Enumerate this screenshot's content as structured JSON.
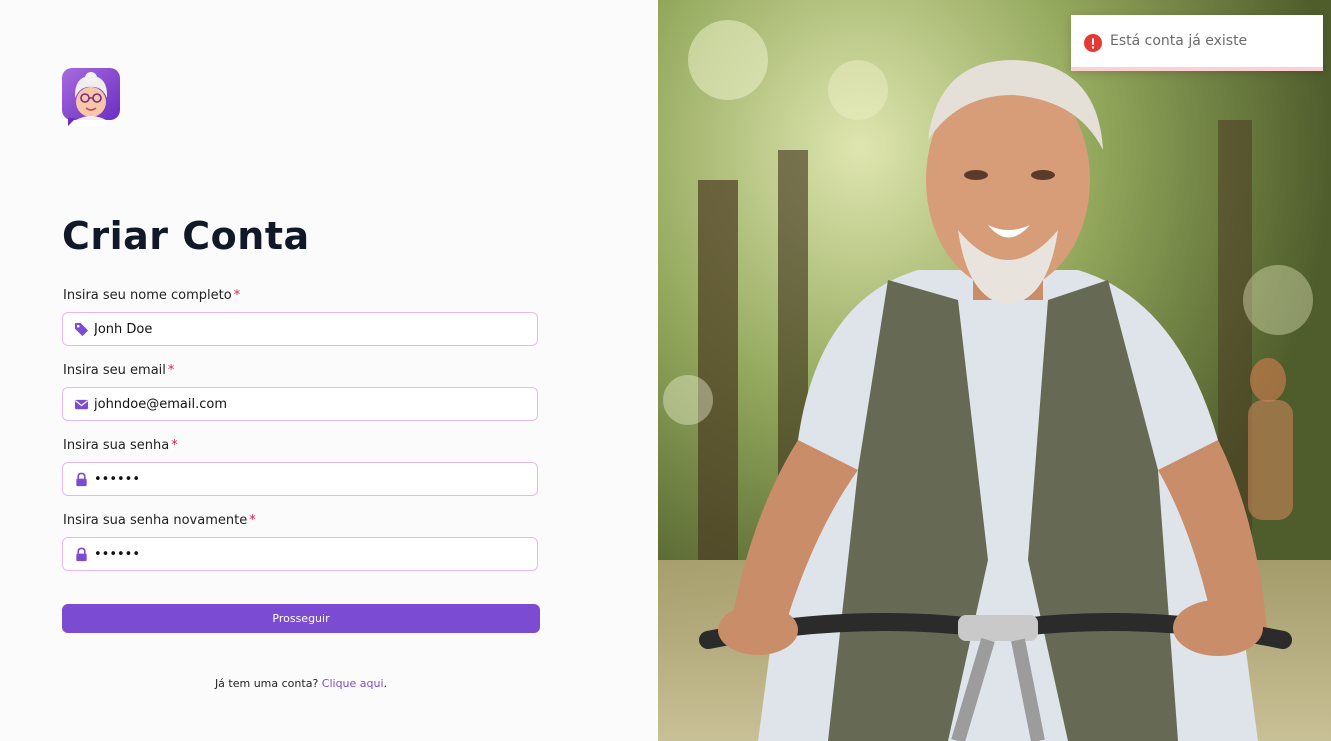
{
  "form": {
    "title": "Criar Conta",
    "name": {
      "label": "Insira seu nome completo",
      "required_mark": "*",
      "value": "Jonh Doe",
      "icon": "tag-icon"
    },
    "email": {
      "label": "Insira seu email",
      "required_mark": "*",
      "value": "johndoe@email.com",
      "icon": "envelope-icon"
    },
    "password": {
      "label": "Insira sua senha",
      "required_mark": "*",
      "value": "••••••",
      "icon": "lock-icon"
    },
    "password_confirm": {
      "label": "Insira sua senha novamente",
      "required_mark": "*",
      "value": "••••••",
      "icon": "lock-icon"
    },
    "submit_label": "Prosseguir",
    "footer_text": "Já tem uma conta?",
    "footer_link": "Clique aqui",
    "footer_period": "."
  },
  "toast": {
    "message": "Está conta já existe",
    "icon": "error-icon",
    "type": "error"
  },
  "colors": {
    "accent": "#7b4cd1",
    "input_border": "#e6b9ee",
    "required": "#e11d48",
    "error": "#e53935"
  }
}
